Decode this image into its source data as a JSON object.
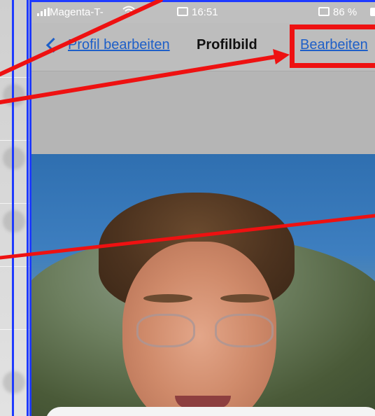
{
  "status_bar": {
    "carrier": "Magenta-T-",
    "time": "16:51",
    "battery": "86 %"
  },
  "nav": {
    "back_label": "Profil bearbeiten",
    "title": "Profilbild",
    "edit_label": "Bearbeiten"
  },
  "colors": {
    "accent": "#1e5fc8",
    "annotation_red": "#ee1111",
    "frame_blue": "#1f3bff"
  },
  "icons": [
    "chevron-left-icon",
    "signal-icon",
    "wifi-icon",
    "screen-mirror-icon",
    "battery-icon"
  ]
}
